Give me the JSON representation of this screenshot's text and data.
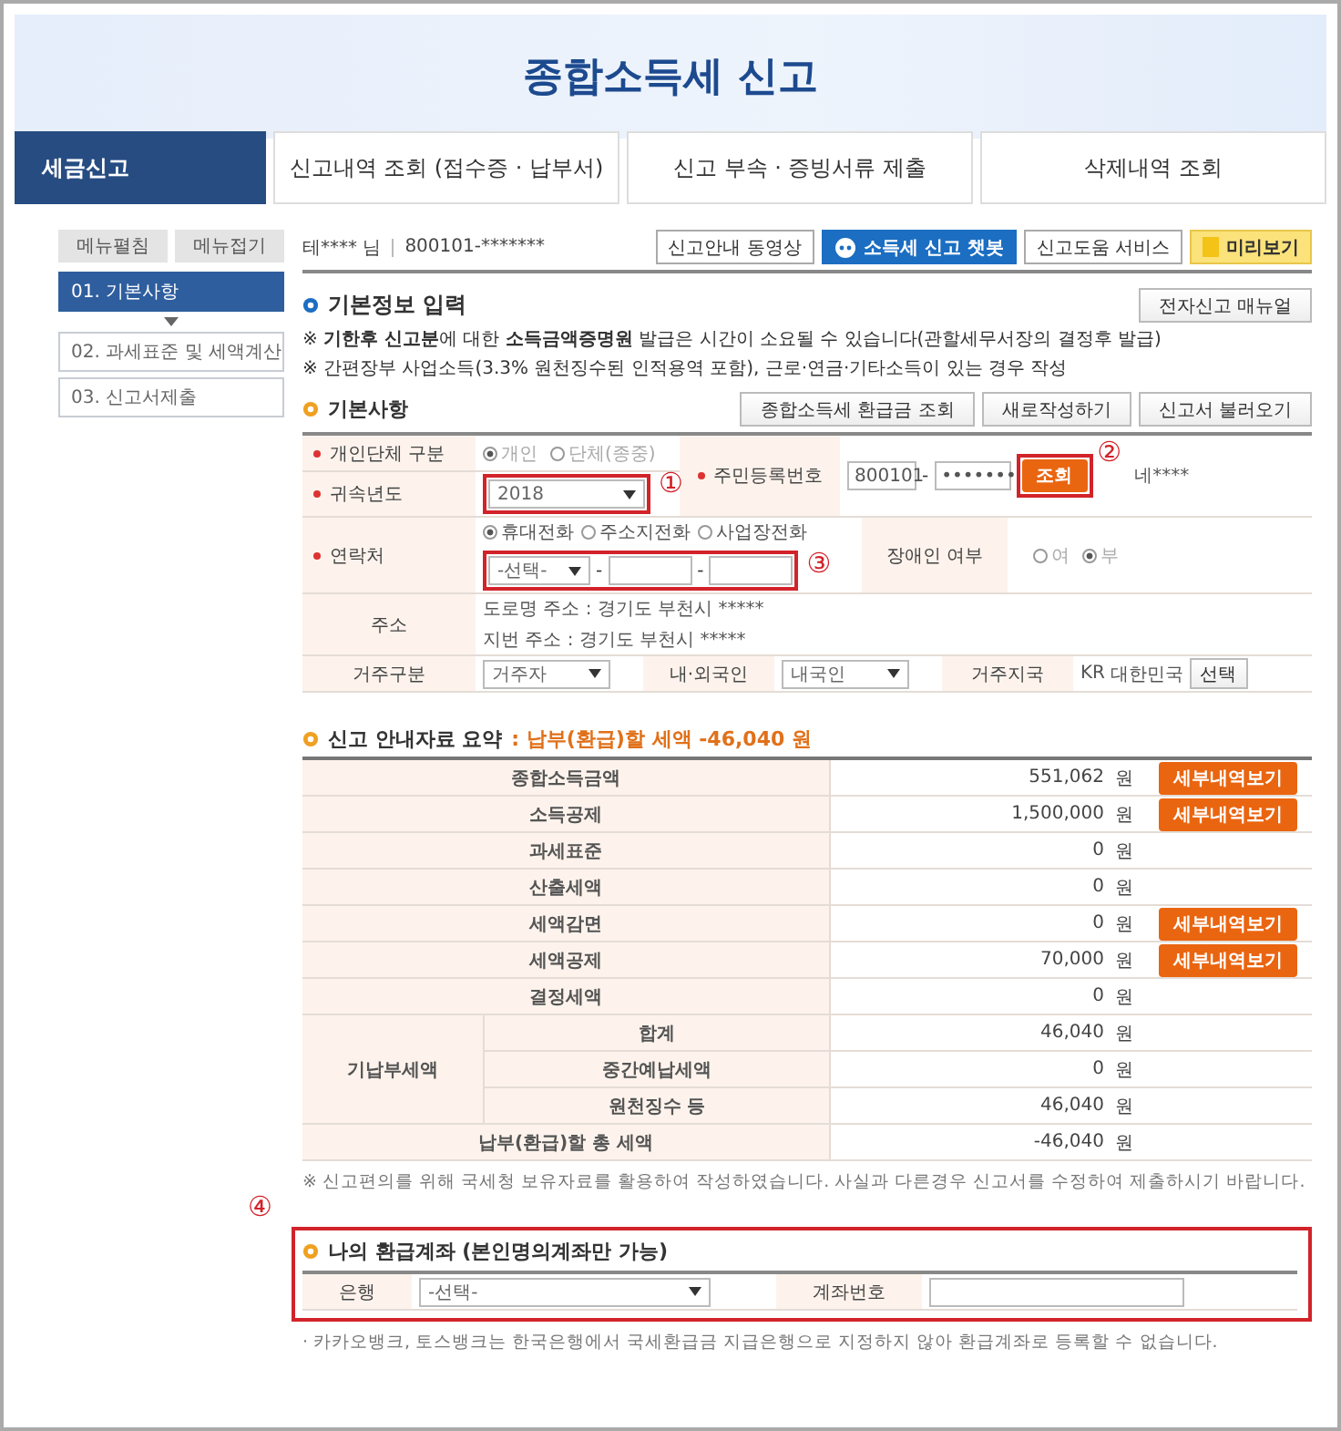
{
  "header": {
    "title": "종합소득세 신고"
  },
  "tabs": [
    {
      "label": "세금신고",
      "selected": true
    },
    {
      "label": "신고내역 조회 (접수증 · 납부서)",
      "selected": false
    },
    {
      "label": "신고 부속 · 증빙서류 제출",
      "selected": false
    },
    {
      "label": "삭제내역 조회",
      "selected": false
    }
  ],
  "sidebar": {
    "buttons": [
      "메뉴펼침",
      "메뉴접기"
    ],
    "steps": [
      {
        "label": "01. 기본사항",
        "selected": true
      },
      {
        "label": "02. 과세표준 및 세액계산",
        "selected": false
      },
      {
        "label": "03. 신고서제출",
        "selected": false
      }
    ]
  },
  "user_bar": {
    "name": "테**** 님",
    "id": "800101-*******",
    "buttons": [
      {
        "label": "신고안내 동영상",
        "kind": "plain"
      },
      {
        "label": "소득세 신고 챗봇",
        "kind": "chatbot"
      },
      {
        "label": "신고도움 서비스",
        "kind": "plain"
      },
      {
        "label": "미리보기",
        "kind": "preview"
      }
    ]
  },
  "basic_info": {
    "title": "기본정보 입력",
    "manual_button": "전자신고 매뉴얼",
    "notes": [
      "※ **기한후 신고분**에 대한 **소득금액증명원** 발급은 시간이 소요될 수 있습니다(관할세무서장의 결정후 발급)",
      "※ 간편장부 사업소득(3.3% 원천징수된 인적용역 포함), 근로·연금·기타소득이 있는 경우 작성"
    ]
  },
  "basic_items": {
    "title": "기본사항",
    "buttons": [
      "종합소득세 환급금 조회",
      "새로작성하기",
      "신고서 불러오기"
    ],
    "separator": "-",
    "entity_type": {
      "required": true,
      "label": "개인단체 구분",
      "options": [
        {
          "label": "개인",
          "selected": true
        },
        {
          "label": "단체(종중)",
          "selected": false
        }
      ]
    },
    "year": {
      "required": true,
      "label": "귀속년도",
      "value": "2018",
      "marker": "①"
    },
    "resident_no": {
      "required": true,
      "label": "주민등록번호",
      "front": "800101",
      "back": "•••••••",
      "button": "조회",
      "marker": "②",
      "name": "네****"
    },
    "contact": {
      "required": true,
      "label": "연락처",
      "options": [
        {
          "label": "휴대전화",
          "selected": true
        },
        {
          "label": "주소지전화",
          "selected": false
        },
        {
          "label": "사업장전화",
          "selected": false
        }
      ],
      "area": "-선택-",
      "marker": "③"
    },
    "disabled_person": {
      "required": false,
      "label": "장애인 여부",
      "options": [
        {
          "label": "여",
          "selected": false
        },
        {
          "label": "부",
          "selected": true
        }
      ]
    },
    "address": {
      "label": "주소",
      "road": "도로명 주소 : 경기도 부천시 *****",
      "lot": "지번 주소 : 경기도 부천시 *****"
    },
    "residency": {
      "label": "거주구분",
      "value": "거주자"
    },
    "nationality": {
      "label": "내·외국인",
      "value": "내국인"
    },
    "country": {
      "label": "거주지국",
      "code": "KR",
      "name": "대한민국",
      "button": "선택"
    }
  },
  "summary": {
    "title": "신고 안내자료 요약",
    "result": ": 납부(환급)할 세액 -46,040 원",
    "rows": [
      {
        "kind": "single",
        "label": "종합소득금액",
        "amount": "551,062",
        "unit": "원",
        "button": "세부내역보기"
      },
      {
        "kind": "single",
        "label": "소득공제",
        "amount": "1,500,000",
        "unit": "원",
        "button": "세부내역보기"
      },
      {
        "kind": "single",
        "label": "과세표준",
        "amount": "0",
        "unit": "원"
      },
      {
        "kind": "single",
        "label": "산출세액",
        "amount": "0",
        "unit": "원"
      },
      {
        "kind": "single",
        "label": "세액감면",
        "amount": "0",
        "unit": "원",
        "button": "세부내역보기"
      },
      {
        "kind": "single",
        "label": "세액공제",
        "amount": "70,000",
        "unit": "원",
        "button": "세부내역보기"
      },
      {
        "kind": "single",
        "label": "결정세액",
        "amount": "0",
        "unit": "원"
      },
      {
        "kind": "group",
        "label": "기납부세액",
        "children": [
          {
            "label": "합계",
            "amount": "46,040",
            "unit": "원"
          },
          {
            "label": "중간예납세액",
            "amount": "0",
            "unit": "원"
          },
          {
            "label": "원천징수 등",
            "amount": "46,040",
            "unit": "원"
          }
        ]
      },
      {
        "kind": "single",
        "label": "납부(환급)할 총 세액",
        "amount": "-46,040",
        "unit": "원"
      }
    ],
    "note": "※ 신고편의를 위해 국세청 보유자료를 활용하여 작성하였습니다. 사실과 다른경우 신고서를 수정하여 제출하시기 바랍니다."
  },
  "refund": {
    "marker": "④",
    "title": "나의 환급계좌 (본인명의계좌만 가능)",
    "bank_label": "은행",
    "bank_value": "-선택-",
    "account_label": "계좌번호",
    "note": "· 카카오뱅크, 토스뱅크는 한국은행에서 국세환급금 지급은행으로 지정하지 않아 환급계좌로 등록할 수 없습니다."
  }
}
